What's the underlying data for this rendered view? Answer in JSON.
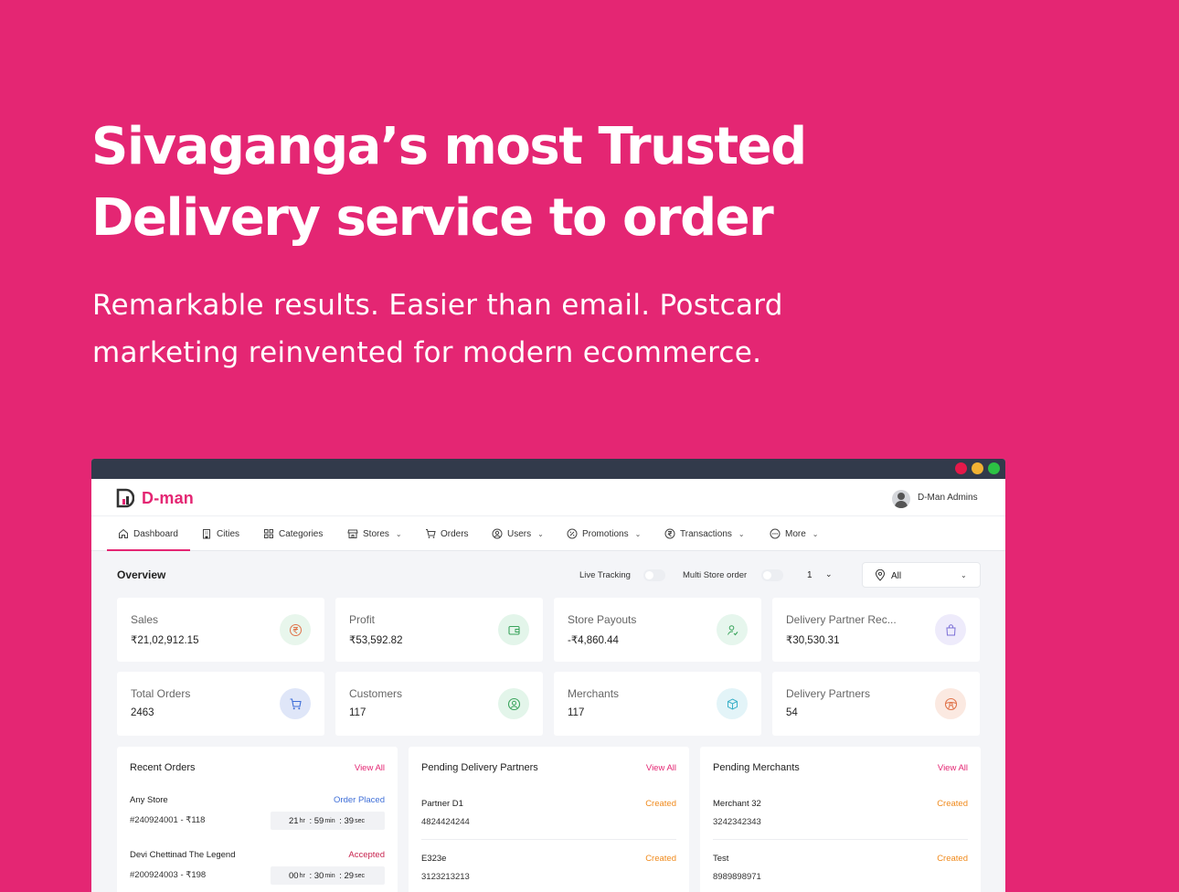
{
  "hero": {
    "title_line1": "Sivaganga’s most Trusted",
    "title_line2": "Delivery service to order",
    "subtitle_line1": "Remarkable results. Easier than email. Postcard",
    "subtitle_line2": "marketing reinvented for modern ecommerce."
  },
  "app": {
    "brand": "D-man",
    "user_name": "D-Man Admins"
  },
  "nav": [
    {
      "label": "Dashboard",
      "icon": "home-icon",
      "active": true
    },
    {
      "label": "Cities",
      "icon": "building-icon"
    },
    {
      "label": "Categories",
      "icon": "grid-icon"
    },
    {
      "label": "Stores",
      "icon": "store-icon",
      "dropdown": true
    },
    {
      "label": "Orders",
      "icon": "cart-icon"
    },
    {
      "label": "Users",
      "icon": "user-circle-icon",
      "dropdown": true
    },
    {
      "label": "Promotions",
      "icon": "badge-icon",
      "dropdown": true
    },
    {
      "label": "Transactions",
      "icon": "rupee-coin-icon",
      "dropdown": true
    },
    {
      "label": "More",
      "icon": "more-circle-icon",
      "dropdown": true
    }
  ],
  "overview": {
    "title": "Overview",
    "live_tracking_label": "Live Tracking",
    "multi_store_label": "Multi Store order",
    "count_select_value": "1",
    "city_select_value": "All"
  },
  "stats": [
    {
      "label": "Sales",
      "value": "₹21,02,912.15",
      "icon": "rupee-icon",
      "color": "#3aa45c"
    },
    {
      "label": "Profit",
      "value": "₹53,592.82",
      "icon": "wallet-icon",
      "color": "#3aa45c"
    },
    {
      "label": "Store Payouts",
      "value": "-₹4,860.44",
      "icon": "user-check-icon",
      "color": "#3aa45c"
    },
    {
      "label": "Delivery Partner Rec...",
      "value": "₹30,530.31",
      "icon": "bag-icon",
      "color": "#7b6fd6"
    },
    {
      "label": "Total Orders",
      "value": "2463",
      "icon": "cart-icon",
      "color": "#3f6fd8"
    },
    {
      "label": "Customers",
      "value": "117",
      "icon": "user-circle-icon",
      "color": "#3aa45c"
    },
    {
      "label": "Merchants",
      "value": "117",
      "icon": "box-icon",
      "color": "#3ab0c8"
    },
    {
      "label": "Delivery Partners",
      "value": "54",
      "icon": "steering-icon",
      "color": "#e0734a"
    }
  ],
  "recent_orders": {
    "title": "Recent Orders",
    "view_all": "View All",
    "rows": [
      {
        "store": "Any Store",
        "status": "Order Placed",
        "order": "#240924001 - ₹118",
        "hr": "21",
        "min": "59",
        "sec": "39"
      },
      {
        "store": "Devi Chettinad The Legend",
        "status": "Accepted",
        "order": "#200924003 - ₹198",
        "hr": "00",
        "min": "30",
        "sec": "29"
      }
    ],
    "units": {
      "hr": "hr",
      "min": "min",
      "sec": "sec"
    }
  },
  "pending_partners": {
    "title": "Pending Delivery Partners",
    "view_all": "View All",
    "rows": [
      {
        "name": "Partner D1",
        "phone": "4824424244",
        "status": "Created"
      },
      {
        "name": "E323e",
        "phone": "3123213213",
        "status": "Created"
      }
    ]
  },
  "pending_merchants": {
    "title": "Pending Merchants",
    "view_all": "View All",
    "rows": [
      {
        "name": "Merchant 32",
        "phone": "3242342343",
        "status": "Created"
      },
      {
        "name": "Test",
        "phone": "8989898971",
        "status": "Created"
      }
    ]
  },
  "colors": {
    "brand": "#e42673",
    "order_placed": "#3f6fd8",
    "accepted": "#c8244f",
    "created": "#f08a1c"
  }
}
